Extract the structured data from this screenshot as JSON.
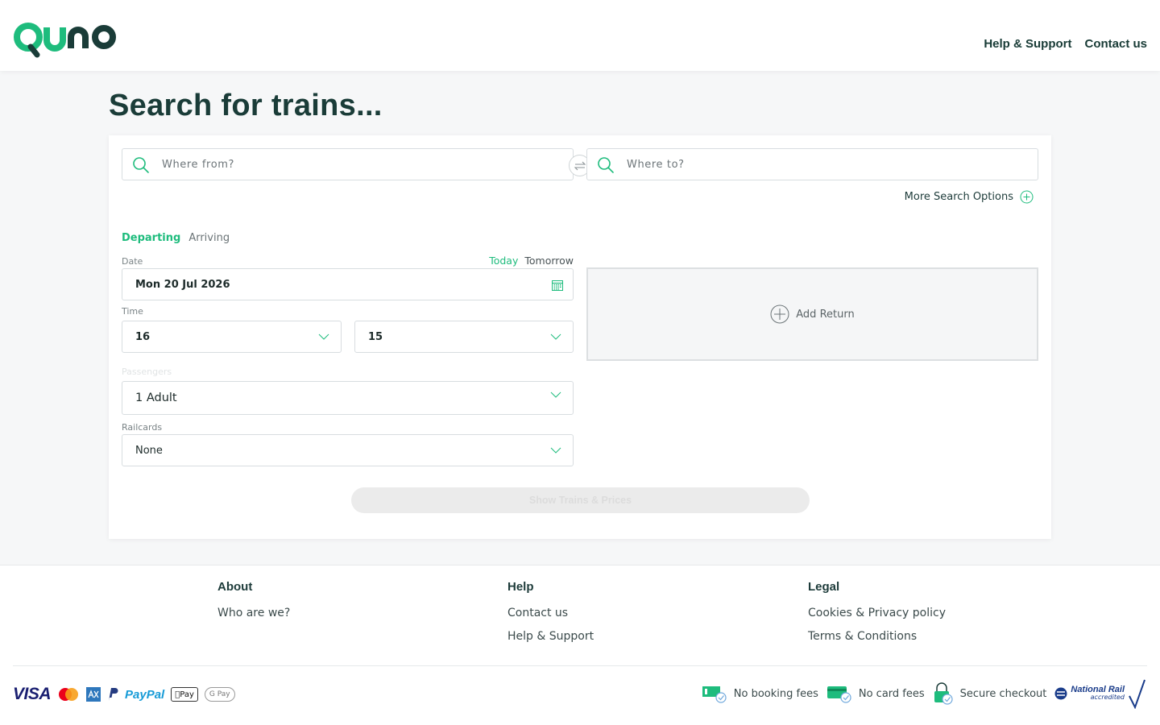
{
  "brand": {
    "name": "Quno",
    "accent": "#1ebc7d",
    "dark": "#1a3c38"
  },
  "topnav": {
    "help": "Help & Support",
    "contact": "Contact us"
  },
  "page": {
    "title": "Search for trains..."
  },
  "search": {
    "from_placeholder": "Where from?",
    "to_placeholder": "Where to?",
    "more_options": "More Search Options",
    "tab_departing": "Departing",
    "tab_arriving": "Arriving",
    "date_label": "Date",
    "today": "Today",
    "tomorrow": "Tomorrow",
    "date_value": "Mon 20 Jul 2026",
    "time_label": "Time",
    "hour": "16",
    "minute": "15",
    "passengers_label": "Passengers",
    "passengers_value": "1 Adult",
    "railcards_label": "Railcards",
    "railcards_value": "None",
    "add_return": "Add Return",
    "submit": "Show Trains & Prices"
  },
  "footer": {
    "about": {
      "title": "About",
      "links": [
        "Who are we?"
      ]
    },
    "help": {
      "title": "Help",
      "links": [
        "Contact us",
        "Help & Support"
      ]
    },
    "legal": {
      "title": "Legal",
      "links": [
        "Cookies & Privacy policy",
        "Terms & Conditions"
      ]
    },
    "payment_methods": [
      "VISA",
      "Mastercard",
      "American Express",
      "PayPal",
      "Apple Pay",
      "Google Pay"
    ],
    "assurances": [
      "No booking fees",
      "No card fees",
      "Secure checkout"
    ],
    "accreditation": {
      "line1": "National Rail",
      "line2": "accredited"
    }
  }
}
